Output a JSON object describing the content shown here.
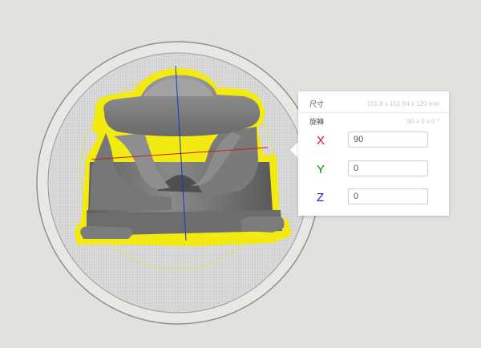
{
  "panel": {
    "size_label": "尺寸",
    "size_value": "101.8 x 151.94 x 120 mm",
    "rotate_label": "旋轉",
    "rotate_value": "90 x 0 x 0 °"
  },
  "axes": {
    "x": {
      "label": "X",
      "value": "90",
      "color": "#d21414"
    },
    "y": {
      "label": "Y",
      "value": "0",
      "color": "#158a15"
    },
    "z": {
      "label": "Z",
      "value": "0",
      "color": "#1a1ab4"
    }
  },
  "colors": {
    "model_gray": "#6e6e6e",
    "outline_yellow": "#f0e81a",
    "grid_line": "#bdbdbd",
    "axis_red": "#c81e1e",
    "axis_blue": "#1e32c8"
  }
}
